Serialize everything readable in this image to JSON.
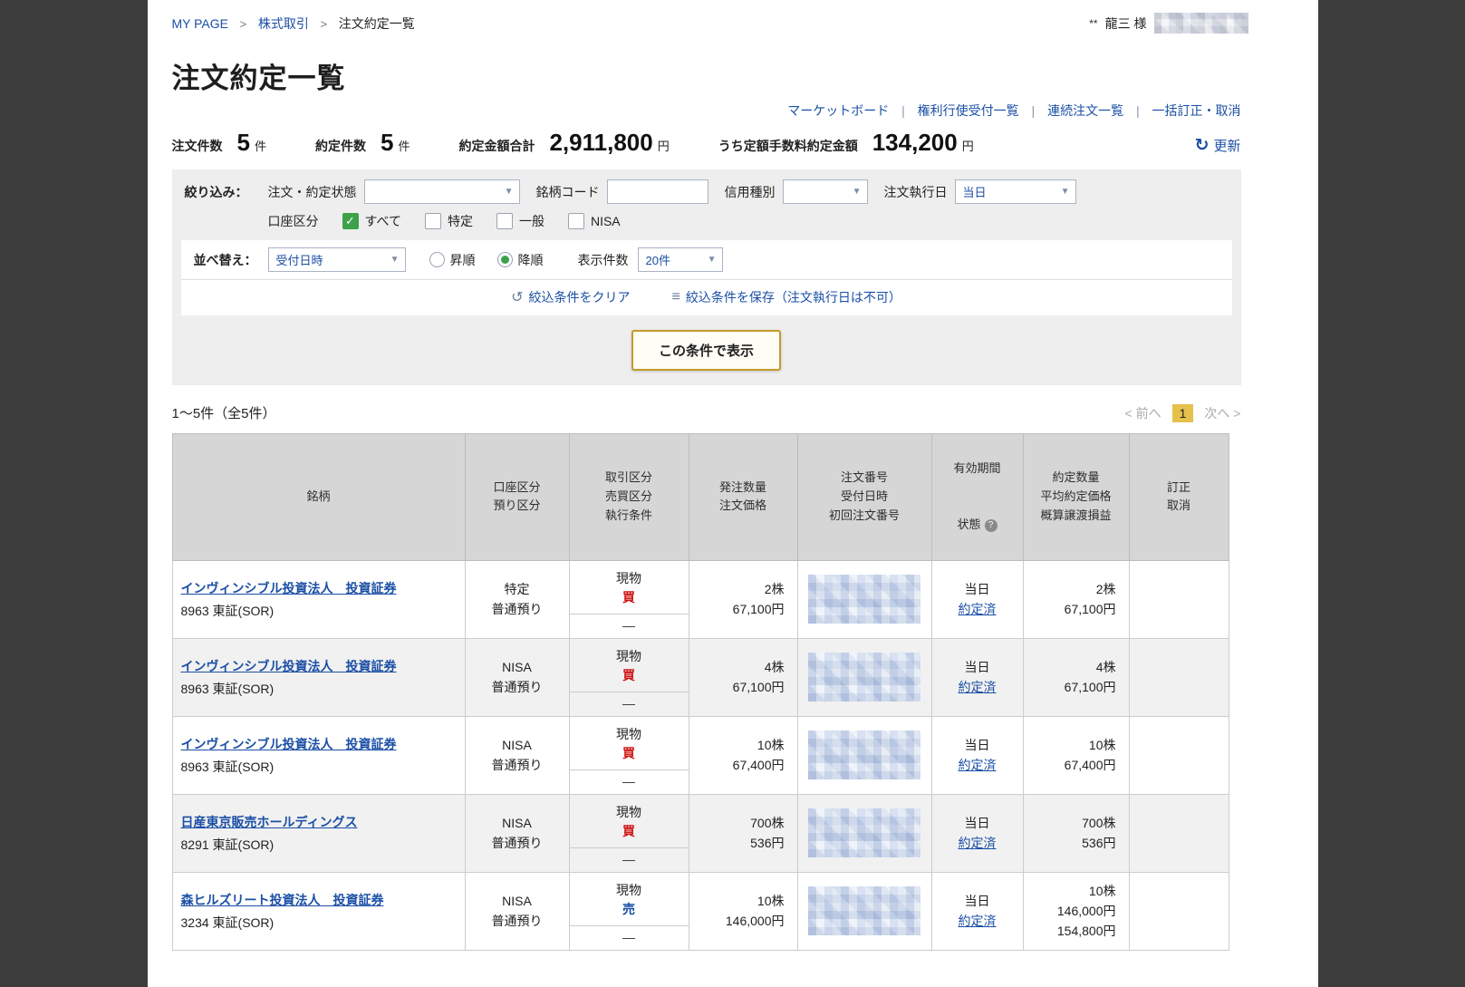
{
  "colors": {
    "link_blue": "#1b4fa5",
    "buy_red": "#cf1717",
    "sell_blue": "#1b4fa5",
    "accent_gold": "#c39b2a",
    "pagination_gold": "#e5c04a",
    "check_green": "#3da14a"
  },
  "icons": {
    "chevron_down": "▼",
    "refresh": "↻",
    "undo": "↺",
    "list": "≡",
    "check": "✓",
    "help": "?"
  },
  "breadcrumb": {
    "items": [
      "MY PAGE",
      "株式取引",
      "注文約定一覧"
    ],
    "separator": ">"
  },
  "user": {
    "stars": "**",
    "name": "龍三 様"
  },
  "title": "注文約定一覧",
  "nav_links": {
    "items": [
      "マーケットボード",
      "権利行使受付一覧",
      "連続注文一覧",
      "一括訂正・取消"
    ],
    "separator": "|"
  },
  "stats": {
    "order_count_label": "注文件数",
    "order_count_value": "5",
    "order_count_unit": "件",
    "exec_count_label": "約定件数",
    "exec_count_value": "5",
    "exec_count_unit": "件",
    "exec_amount_label": "約定金額合計",
    "exec_amount_value": "2,911,800",
    "exec_amount_unit": "円",
    "flat_fee_label": "うち定額手数料約定金額",
    "flat_fee_value": "134,200",
    "flat_fee_unit": "円",
    "refresh_label": "更新"
  },
  "filter": {
    "narrow_label": "絞り込み：",
    "order_state_label": "注文・約定状態",
    "order_state_value": "",
    "stock_code_label": "銘柄コード",
    "stock_code_value": "",
    "margin_type_label": "信用種別",
    "margin_type_value": "",
    "exec_date_label": "注文執行日",
    "exec_date_value": "当日",
    "account_label": "口座区分",
    "account_all": "すべて",
    "account_tokutei": "特定",
    "account_ippan": "一般",
    "account_nisa": "NISA",
    "sort_label": "並べ替え：",
    "sort_key_value": "受付日時",
    "asc_label": "昇順",
    "desc_label": "降順",
    "page_size_label": "表示件数",
    "page_size_value": "20件",
    "clear_link": "絞込条件をクリア",
    "save_link": "絞込条件を保存（注文執行日は不可）",
    "submit_label": "この条件で表示"
  },
  "pagination": {
    "range_text": "1〜5件（全5件）",
    "prev_label": "< 前へ",
    "current_page": "1",
    "next_label": "次へ >"
  },
  "table": {
    "headers": {
      "stock": "銘柄",
      "account": "口座区分\n預り区分",
      "trade": "取引区分\n売買区分\n執行条件",
      "qty": "発注数量\n注文価格",
      "order_no": "注文番号\n受付日時\n初回注文番号",
      "validity_line1": "有効期間",
      "validity_line2": "状態",
      "exec": "約定数量\n平均約定価格\n概算譲渡損益",
      "modify": "訂正\n取消"
    },
    "rows": [
      {
        "name": "インヴィンシブル投資法人　投資証券",
        "code": "8963 東証(SOR)",
        "account": "特定",
        "deposit": "普通預り",
        "trade_type": "現物",
        "side": "買",
        "side_color": "#cf1717",
        "exec_cond": "―",
        "order_qty": "2株",
        "order_price": "67,100円",
        "validity": "当日",
        "status": "約定済",
        "exec_qty": "2株",
        "exec_price": "67,100円",
        "exec_pl": ""
      },
      {
        "name": "インヴィンシブル投資法人　投資証券",
        "code": "8963 東証(SOR)",
        "account": "NISA",
        "deposit": "普通預り",
        "trade_type": "現物",
        "side": "買",
        "side_color": "#cf1717",
        "exec_cond": "―",
        "order_qty": "4株",
        "order_price": "67,100円",
        "validity": "当日",
        "status": "約定済",
        "exec_qty": "4株",
        "exec_price": "67,100円",
        "exec_pl": ""
      },
      {
        "name": "インヴィンシブル投資法人　投資証券",
        "code": "8963 東証(SOR)",
        "account": "NISA",
        "deposit": "普通預り",
        "trade_type": "現物",
        "side": "買",
        "side_color": "#cf1717",
        "exec_cond": "―",
        "order_qty": "10株",
        "order_price": "67,400円",
        "validity": "当日",
        "status": "約定済",
        "exec_qty": "10株",
        "exec_price": "67,400円",
        "exec_pl": ""
      },
      {
        "name": "日産東京販売ホールディングス",
        "code": "8291 東証(SOR)",
        "account": "NISA",
        "deposit": "普通預り",
        "trade_type": "現物",
        "side": "買",
        "side_color": "#cf1717",
        "exec_cond": "―",
        "order_qty": "700株",
        "order_price": "536円",
        "validity": "当日",
        "status": "約定済",
        "exec_qty": "700株",
        "exec_price": "536円",
        "exec_pl": ""
      },
      {
        "name": "森ヒルズリート投資法人　投資証券",
        "code": "3234 東証(SOR)",
        "account": "NISA",
        "deposit": "普通預り",
        "trade_type": "現物",
        "side": "売",
        "side_color": "#1b4fa5",
        "exec_cond": "―",
        "order_qty": "10株",
        "order_price": "146,000円",
        "validity": "当日",
        "status": "約定済",
        "exec_qty": "10株",
        "exec_price": "146,000円",
        "exec_pl": "154,800円"
      }
    ]
  }
}
